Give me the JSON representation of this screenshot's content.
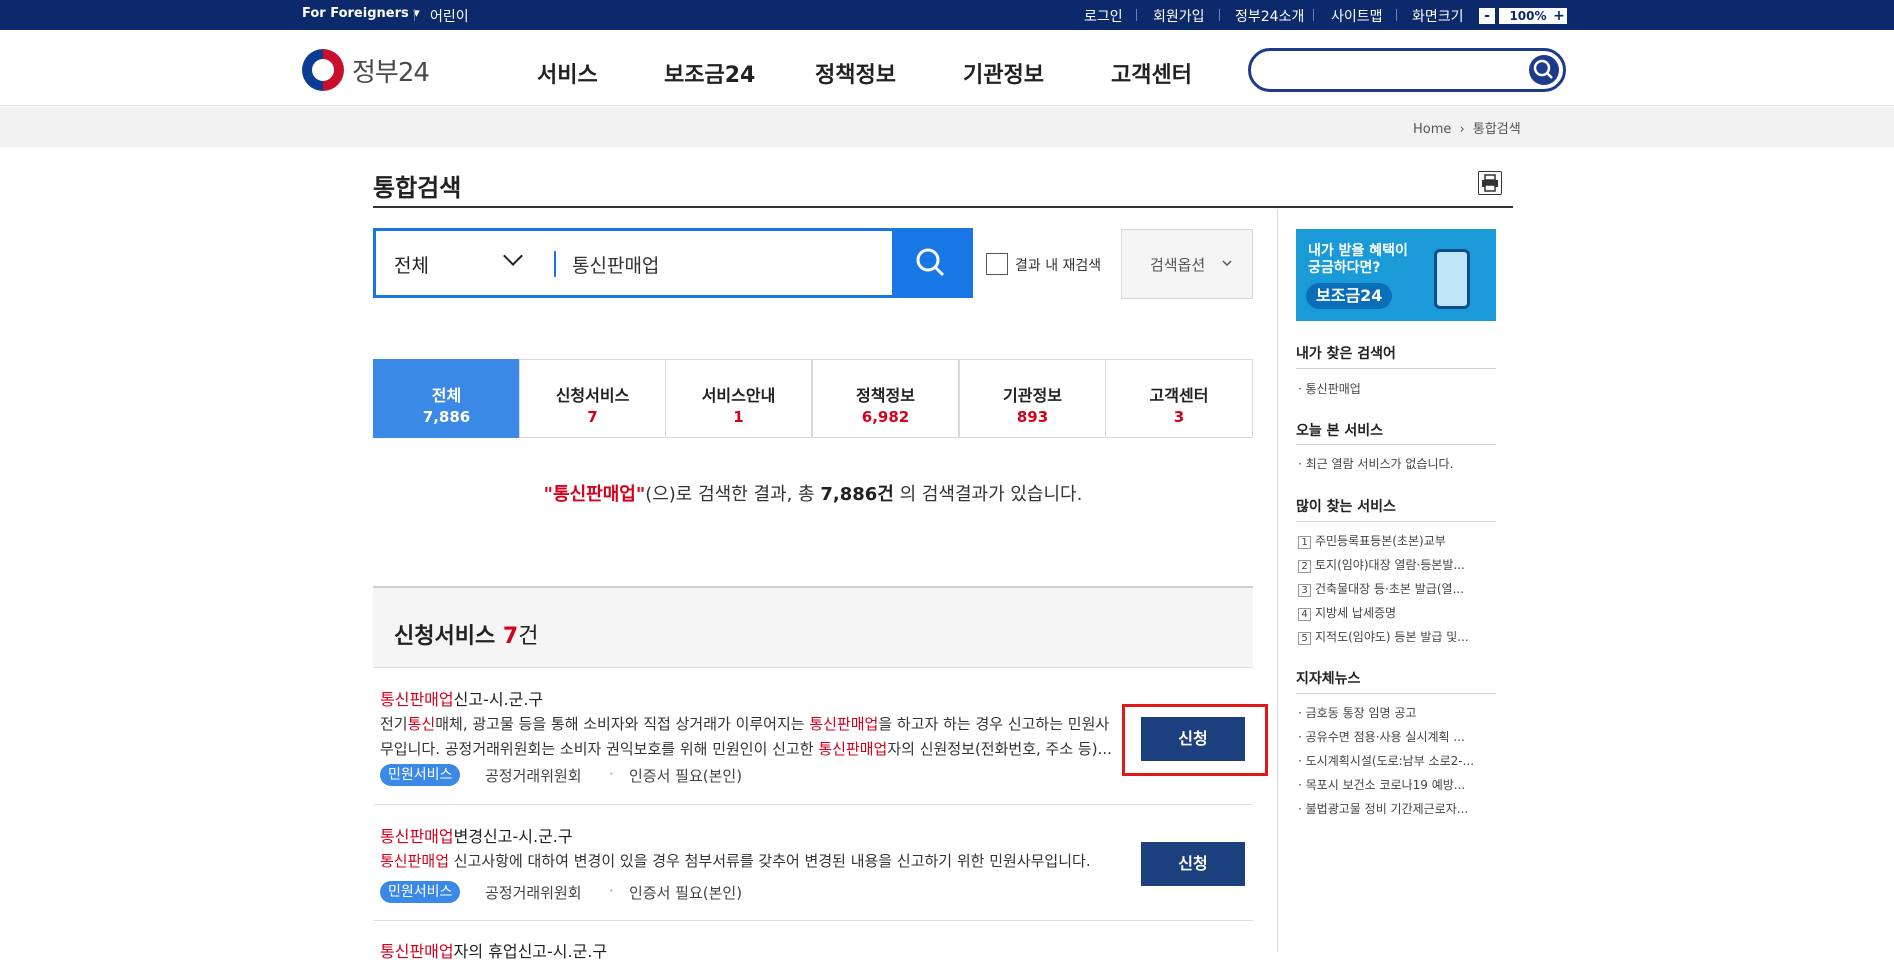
{
  "util": {
    "foreigners": "For Foreigners ▾",
    "kids": "어린이",
    "login": "로그인",
    "join": "회원가입",
    "about": "정부24소개",
    "sitemap": "사이트맵",
    "zoom_label": "화면크기",
    "zoom_minus": "-",
    "zoom_value": "100%",
    "zoom_plus": "+"
  },
  "header": {
    "logo": "정부24",
    "nav": [
      "서비스",
      "보조금24",
      "정책정보",
      "기관정보",
      "고객센터"
    ]
  },
  "breadcrumb": {
    "home": "Home",
    "sep": "›",
    "current": "통합검색"
  },
  "page": {
    "title": "통합검색"
  },
  "search": {
    "category": "전체",
    "query": "통신판매업",
    "recheck": "결과 내 재검색",
    "options": "검색옵션"
  },
  "tabs": [
    {
      "label": "전체",
      "count": "7,886"
    },
    {
      "label": "신청서비스",
      "count": "7"
    },
    {
      "label": "서비스안내",
      "count": "1"
    },
    {
      "label": "정책정보",
      "count": "6,982"
    },
    {
      "label": "기관정보",
      "count": "893"
    },
    {
      "label": "고객센터",
      "count": "3"
    }
  ],
  "summary": {
    "keyword": "\"통신판매업\"",
    "mid": "(으)로 검색한 결과, 총 ",
    "total": "7,886건",
    "tail": " 의 검색결과가 있습니다."
  },
  "section": {
    "title": "신청서비스 ",
    "count": "7",
    "unit": "건"
  },
  "results": [
    {
      "title_hl": "통신판매업",
      "title_rest": "신고-시.군.구",
      "desc_line1_a": "전기",
      "desc_line1_hl1": "통신",
      "desc_line1_b": "매체, 광고물 등을 통해 소비자와 직접 상거래가 이루어지는 ",
      "desc_line1_hl2": "통신판매업",
      "desc_line1_c": "을 하고자 하는 경우 신고하는 민원사",
      "desc_line2_a": "무입니다. 공정거래위원회는 소비자 권익보호를 위해 민원인이 신고한 ",
      "desc_line2_hl": "통신판매업",
      "desc_line2_b": "자의 신원정보(전화번호, 주소 등)...",
      "badge": "민원서비스",
      "agency": "공정거래위원회",
      "cert": "인증서 필요(본인)",
      "button": "신청"
    },
    {
      "title_hl": "통신판매업",
      "title_rest": "변경신고-시.군.구",
      "desc_hl": "통신판매업",
      "desc_rest": " 신고사항에 대하여 변경이 있을 경우 첨부서류를 갖추어 변경된 내용을 신고하기 위한 민원사무입니다.",
      "badge": "민원서비스",
      "agency": "공정거래위원회",
      "cert": "인증서 필요(본인)",
      "button": "신청"
    },
    {
      "title_hl": "통신판매업",
      "title_rest": "자의 휴업신고-시.군.구"
    }
  ],
  "rail": {
    "banner_line1": "내가 받을 혜택이",
    "banner_line2": "궁금하다면?",
    "banner_pill": "보조금24",
    "my_searches_title": "내가 찾은 검색어",
    "my_searches": [
      "통신판매업"
    ],
    "today_title": "오늘 본 서비스",
    "today_empty": "최근 열람 서비스가 없습니다.",
    "popular_title": "많이 찾는 서비스",
    "popular": [
      "주민등록표등본(초본)교부",
      "토지(임야)대장 열람·등본발...",
      "건축물대장 등·초본 발급(열...",
      "지방세 납세증명",
      "지적도(임야도) 등본 발급 및..."
    ],
    "news_title": "지자체뉴스",
    "news": [
      "금호동 통장 임명 공고",
      "공유수면 점용·사용 실시계획 ...",
      "도시계획시설(도로:남부 소로2-...",
      "목포시 보건소 코로나19 예방...",
      "불법광고물 정비 기간제근로자..."
    ]
  }
}
